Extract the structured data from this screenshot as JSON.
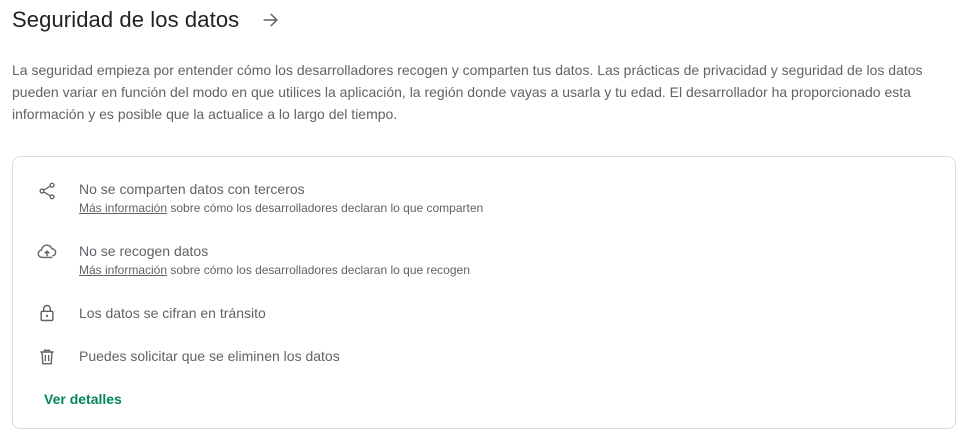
{
  "header": {
    "title": "Seguridad de los datos"
  },
  "description": "La seguridad empieza por entender cómo los desarrolladores recogen y comparten tus datos. Las prácticas de privacidad y seguridad de los datos pueden variar en función del modo en que utilices la aplicación, la región donde vayas a usarla y tu edad. El desarrollador ha proporcionado esta información y es posible que la actualice a lo largo del tiempo.",
  "card": {
    "items": [
      {
        "icon": "share-icon",
        "title": "No se comparten datos con terceros",
        "link": "Más información",
        "sub": " sobre cómo los desarrolladores declaran lo que comparten"
      },
      {
        "icon": "cloud-upload-icon",
        "title": "No se recogen datos",
        "link": "Más información",
        "sub": " sobre cómo los desarrolladores declaran lo que recogen"
      },
      {
        "icon": "lock-icon",
        "title": "Los datos se cifran en tránsito"
      },
      {
        "icon": "trash-icon",
        "title": "Puedes solicitar que se eliminen los datos"
      }
    ],
    "details_label": "Ver detalles"
  },
  "colors": {
    "accent": "#01875f",
    "text_primary": "#202124",
    "text_secondary": "#5f6368",
    "border": "#dadce0"
  }
}
